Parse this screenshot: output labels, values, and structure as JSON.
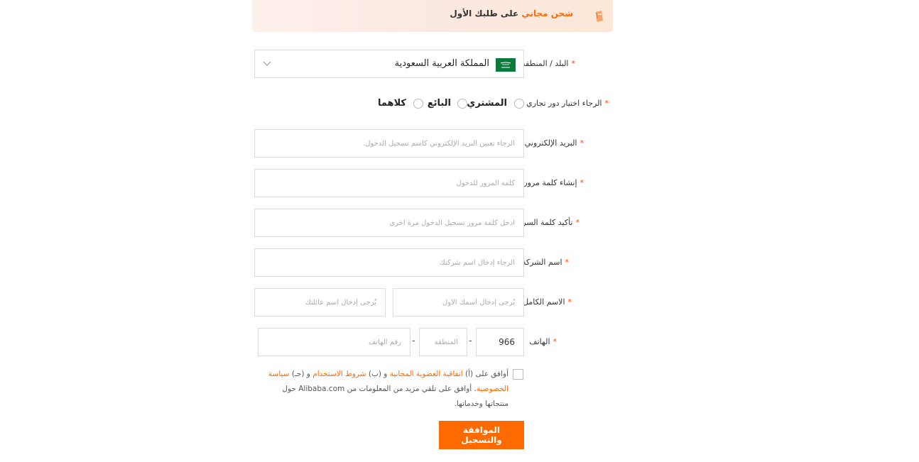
{
  "banner": {
    "highlight": "شحن مجاني",
    "rest": " على طلبك الأول",
    "icon": "package-icon"
  },
  "form": {
    "country": {
      "label": "البلد / المنطقة",
      "value": "المملكة العربية السعودية",
      "flag_icon": "saudi-flag-icon"
    },
    "role": {
      "label": "الرجاء اختيار دور تجاري",
      "options": [
        "المشتري",
        "البائع",
        "كلاهما"
      ]
    },
    "email": {
      "label": "البريد الإلكتروني",
      "placeholder": "الرجاء تعيين البريد الإلكتروني كاسم تسجيل الدخول."
    },
    "password": {
      "label": "إنشاء كلمة مرور",
      "placeholder": "كلمة المرور للدخول"
    },
    "confirm_password": {
      "label": "تأكيد كلمة السر",
      "placeholder": "أدخل كلمة مرور تسجيل الدخول مرة أخرى"
    },
    "company": {
      "label": "اسم الشركة",
      "placeholder": "الرجاء إدخال اسم شركتك"
    },
    "full_name": {
      "label": "الاسم الكامل",
      "first_placeholder": "يُرجى إدخال اسمك الأول",
      "last_placeholder": "يُرجى إدخال اسم عائلتك"
    },
    "phone": {
      "label": "الهاتف",
      "country_code": "966",
      "area_placeholder": "المنطقة",
      "number_placeholder": "رقم الهاتف",
      "separator": "-"
    },
    "required_mark": "*"
  },
  "agreement": {
    "t1": "أوافق على (أ) ",
    "l1": "اتفاقية العضوية المجانية",
    "t2": " و (ب) ",
    "l2": "شروط الاستخدام",
    "t3": " و (جـ) ",
    "l3": "سياسة الخصوصية",
    "t4": ". أوافق على تلقي مزيد من المعلومات من Alibaba.com حول منتجاتها وخدماتها."
  },
  "submit_label": "الموافقة والتسجيل",
  "colors": {
    "accent": "#ff6a00",
    "required": "#ff4c00",
    "border": "#dcdcdc"
  }
}
